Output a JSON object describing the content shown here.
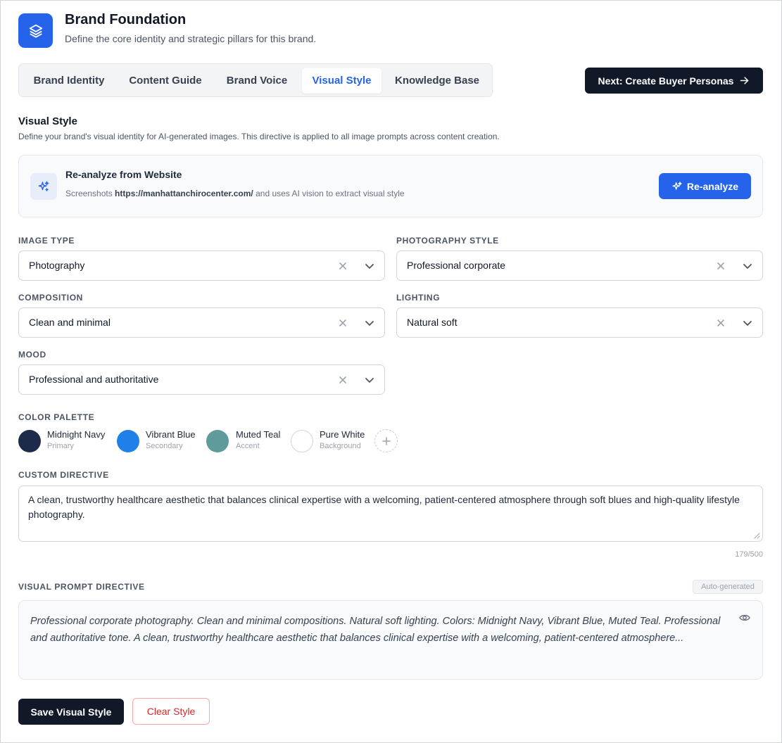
{
  "header": {
    "title": "Brand Foundation",
    "subtitle": "Define the core identity and strategic pillars for this brand.",
    "icon": "layers-icon"
  },
  "tabs": [
    {
      "label": "Brand Identity",
      "active": false
    },
    {
      "label": "Content Guide",
      "active": false
    },
    {
      "label": "Brand Voice",
      "active": false
    },
    {
      "label": "Visual Style",
      "active": true
    },
    {
      "label": "Knowledge Base",
      "active": false
    }
  ],
  "next_button": {
    "label": "Next: Create Buyer Personas",
    "icon": "arrow-right-icon"
  },
  "section": {
    "title": "Visual Style",
    "description": "Define your brand's visual identity for AI-generated images. This directive is applied to all image prompts across content creation."
  },
  "reanalyze": {
    "title": "Re-analyze from Website",
    "desc_prefix": "Screenshots",
    "url": "https://manhattanchirocenter.com/",
    "desc_suffix": "and uses AI vision to extract visual style",
    "button_label": "Re-analyze",
    "icon": "sparkles-icon"
  },
  "fields": {
    "image_type": {
      "label": "IMAGE TYPE",
      "value": "Photography"
    },
    "photography_style": {
      "label": "PHOTOGRAPHY STYLE",
      "value": "Professional corporate"
    },
    "composition": {
      "label": "COMPOSITION",
      "value": "Clean and minimal"
    },
    "lighting": {
      "label": "LIGHTING",
      "value": "Natural soft"
    },
    "mood": {
      "label": "MOOD",
      "value": "Professional and authoritative"
    }
  },
  "palette": {
    "label": "COLOR PALETTE",
    "colors": [
      {
        "name": "Midnight Navy",
        "role": "Primary",
        "hex": "#1e2a4a"
      },
      {
        "name": "Vibrant Blue",
        "role": "Secondary",
        "hex": "#1e80e8"
      },
      {
        "name": "Muted Teal",
        "role": "Accent",
        "hex": "#5f9b9a"
      },
      {
        "name": "Pure White",
        "role": "Background",
        "hex": "#ffffff"
      }
    ]
  },
  "custom_directive": {
    "label": "CUSTOM DIRECTIVE",
    "value": "A clean, trustworthy healthcare aesthetic that balances clinical expertise with a welcoming, patient-centered atmosphere through soft blues and high-quality lifestyle photography.",
    "char_count": "179/500"
  },
  "visual_prompt": {
    "label": "VISUAL PROMPT DIRECTIVE",
    "badge": "Auto-generated",
    "text": "Professional corporate photography. Clean and minimal compositions. Natural soft lighting. Colors: Midnight Navy, Vibrant Blue, Muted Teal. Professional and authoritative tone. A clean, trustworthy healthcare aesthetic that balances clinical expertise with a welcoming, patient-centered atmosphere..."
  },
  "actions": {
    "save_label": "Save Visual Style",
    "clear_label": "Clear Style"
  },
  "colors": {
    "accent": "#2563eb",
    "dark": "#111827",
    "danger": "#dc2626"
  }
}
